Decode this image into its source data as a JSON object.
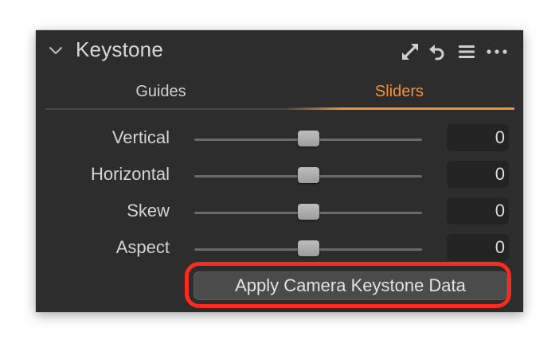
{
  "panel": {
    "title": "Keystone",
    "icons": [
      "chevron-down-icon",
      "expand-arrows-icon",
      "reset-icon",
      "menu-icon",
      "more-icon"
    ]
  },
  "tabs": [
    {
      "label": "Guides",
      "active": false
    },
    {
      "label": "Sliders",
      "active": true
    }
  ],
  "colors": {
    "accent": "#f0923a",
    "panel_bg": "#2d2d2d",
    "highlight": "#ff2a1f"
  },
  "sliders": [
    {
      "label": "Vertical",
      "value": "0",
      "position": 0.5
    },
    {
      "label": "Horizontal",
      "value": "0",
      "position": 0.5
    },
    {
      "label": "Skew",
      "value": "0",
      "position": 0.5
    },
    {
      "label": "Aspect",
      "value": "0",
      "position": 0.5
    }
  ],
  "apply_button": {
    "label": "Apply Camera Keystone Data"
  }
}
